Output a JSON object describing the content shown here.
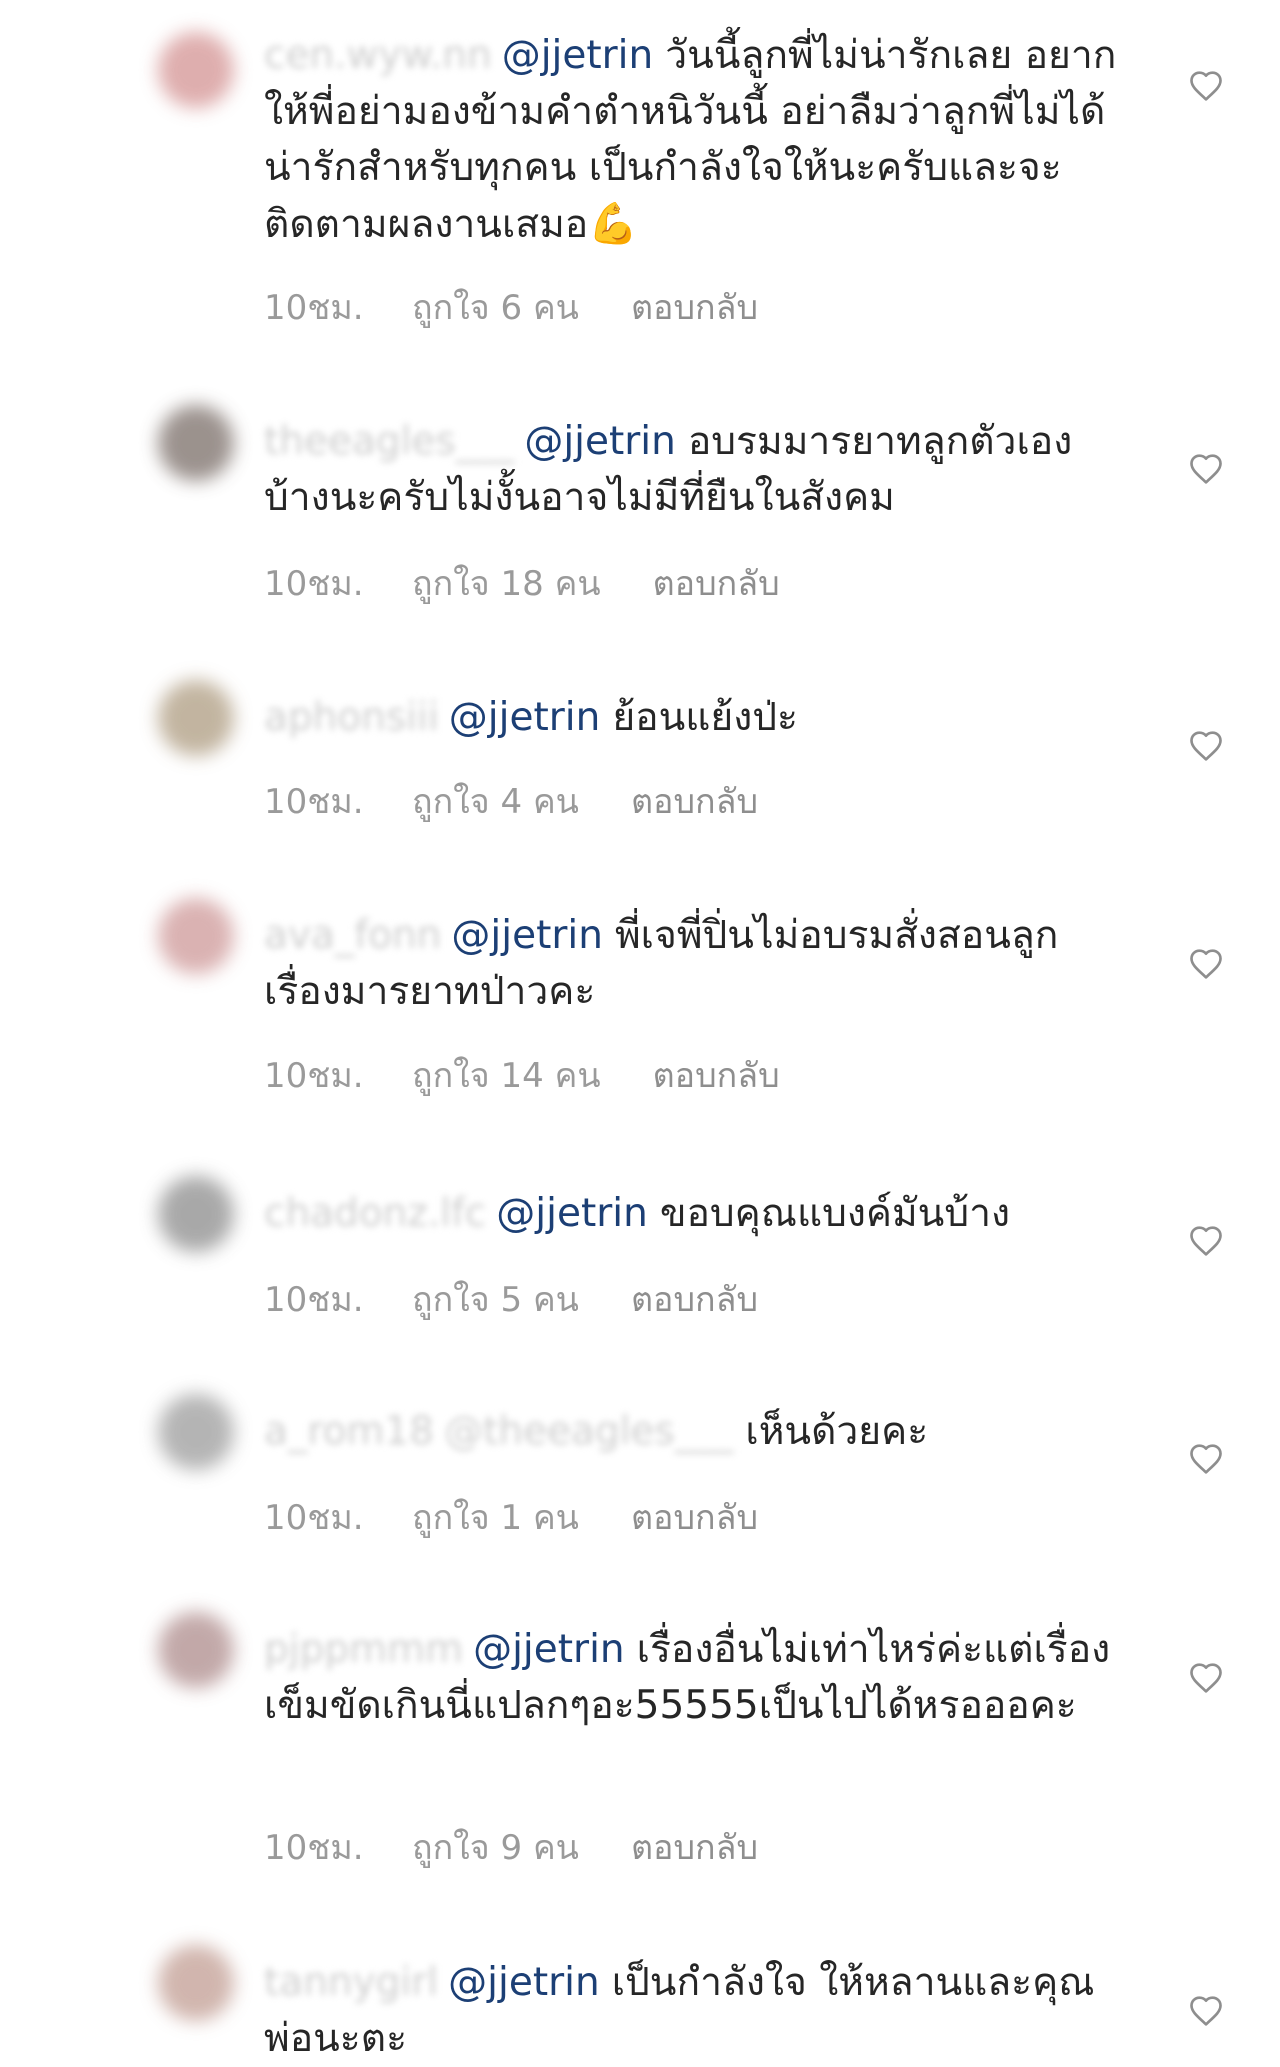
{
  "comments": [
    {
      "username": "cen.wyw.nn",
      "mention": "@jjetrin",
      "text": "วันนี้ลูกพี่ไม่น่ารักเลย อยากให้พี่อย่ามองข้ามคำตำหนิวันนี้ อย่าลืมว่าลูกพี่ไม่ได้น่ารักสำหรับทุกคน เป็นกำลังใจให้นะครับและจะติดตามผลงานเสมอ",
      "emoji": "💪",
      "time": "10ชม.",
      "likes": "ถูกใจ 6 คน",
      "reply": "ตอบกลับ",
      "avatar_color": "#d9a0a0"
    },
    {
      "username": "theeagles___",
      "mention": "@jjetrin",
      "text": "อบรมมารยาทลูกตัวเองบ้างนะครับไม่งั้นอาจไม่มีที่ยืนในสังคม",
      "time": "10ชม.",
      "likes": "ถูกใจ 18 คน",
      "reply": "ตอบกลับ",
      "avatar_color": "#8a7f7a"
    },
    {
      "username": "aphonsiii",
      "mention": "@jjetrin",
      "text": "ย้อนแย้งป่ะ",
      "time": "10ชม.",
      "likes": "ถูกใจ 4 คน",
      "reply": "ตอบกลับ",
      "avatar_color": "#b8a890"
    },
    {
      "username": "ava_fonn",
      "mention": "@jjetrin",
      "text": "พี่เจพี่ปิ่นไม่อบรมสั่งสอนลูกเรื่องมารยาทป่าวคะ",
      "time": "10ชม.",
      "likes": "ถูกใจ 14 คน",
      "reply": "ตอบกลับ",
      "avatar_color": "#d4a5a5"
    },
    {
      "username": "chadonz.lfc",
      "mention": "@jjetrin",
      "text": "ขอบคุณแบงค์มันบ้าง",
      "time": "10ชม.",
      "likes": "ถูกใจ 5 คน",
      "reply": "ตอบกลับ",
      "avatar_color": "#9a9a9a"
    },
    {
      "username": "a_rom18",
      "mention": "@theeagles___",
      "mention_blurred": true,
      "text": "เห็นด้วยคะ",
      "time": "10ชม.",
      "likes": "ถูกใจ 1 คน",
      "reply": "ตอบกลับ",
      "avatar_color": "#a8a8a8"
    },
    {
      "username": "pjppmmm",
      "mention": "@jjetrin",
      "text": "เรื่องอื่นไม่เท่าไหร่ค่ะแต่เรื่องเข็มขัดเกินนี่แปลกๆอะ55555เป็นไปได้หรอออคะ",
      "time": "10ชม.",
      "likes": "ถูกใจ 9 คน",
      "reply": "ตอบกลับ",
      "avatar_color": "#b89a9a"
    },
    {
      "username": "tannygirl",
      "mention": "@jjetrin",
      "text": "เป็นกำลังใจ ให้หลานและคุณพ่อนะตะ",
      "avatar_color": "#c9a9a0"
    }
  ]
}
